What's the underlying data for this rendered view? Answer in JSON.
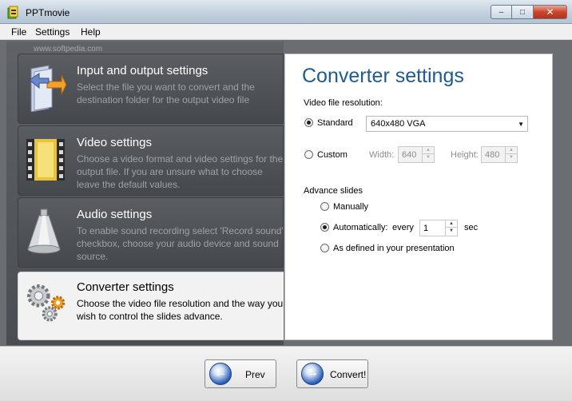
{
  "window": {
    "title": "PPTmovie",
    "min": "–",
    "max": "□",
    "close": "✕"
  },
  "menu": {
    "file": "File",
    "settings": "Settings",
    "help": "Help"
  },
  "watermark": "www.softpedia.com",
  "steps": [
    {
      "title": "Input and output settings",
      "desc": "Select the file you want to convert and the destination folder for the output video file",
      "icon": "folder-arrow-icon"
    },
    {
      "title": "Video settings",
      "desc": "Choose a video format and video settings for the output file. If you are unsure what to choose leave the default values.",
      "icon": "film-strip-icon"
    },
    {
      "title": "Audio settings",
      "desc": "To enable sound recording select 'Record sound' checkbox, choose your audio device and sound source.",
      "icon": "megaphone-icon"
    },
    {
      "title": "Converter settings",
      "desc": "Choose the video file resolution and the way you wish to control the slides advance.",
      "icon": "gears-icon"
    }
  ],
  "converter": {
    "title": "Converter settings",
    "resolution_label": "Video file resolution:",
    "standard_label": "Standard",
    "standard_value": "640x480 VGA",
    "custom_label": "Custom",
    "width_label": "Width:",
    "width_value": "640",
    "height_label": "Height:",
    "height_value": "480",
    "advance_label": "Advance slides",
    "manually_label": "Manually",
    "auto_label": "Automatically:",
    "every_label": "every",
    "every_value": "1",
    "sec_label": "sec",
    "presentation_label": "As defined in your presentation",
    "selected_resolution": "standard",
    "selected_advance": "automatically"
  },
  "buttons": {
    "prev": "Prev",
    "convert": "Convert!"
  },
  "colors": {
    "title_blue": "#1f5a93",
    "nav_blue": "#2b5fb9"
  }
}
